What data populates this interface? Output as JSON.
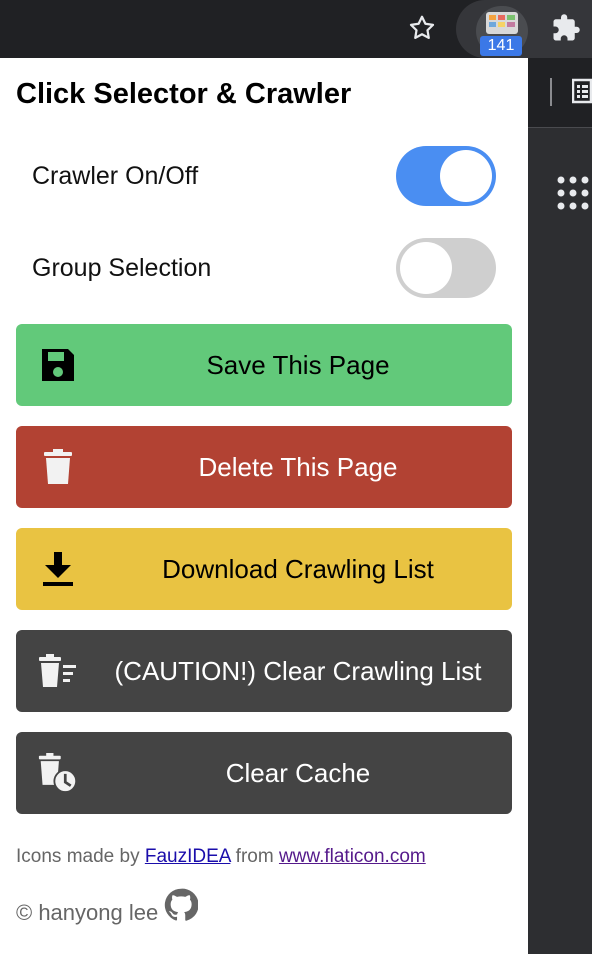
{
  "browser": {
    "extension_badge": "141"
  },
  "popup": {
    "title": "Click Selector & Crawler",
    "toggles": [
      {
        "label": "Crawler On/Off",
        "state": "on"
      },
      {
        "label": "Group Selection",
        "state": "off"
      }
    ],
    "buttons": {
      "save": {
        "label": "Save This Page",
        "icon": "floppy-disk-icon",
        "color": "#62c97a"
      },
      "delete": {
        "label": "Delete This Page",
        "icon": "trash-icon",
        "color": "#b24233"
      },
      "download": {
        "label": "Download Crawling List",
        "icon": "download-icon",
        "color": "#e9c342"
      },
      "clear_list": {
        "label": "(CAUTION!) Clear Crawling List",
        "icon": "trash-list-icon",
        "color": "#444444"
      },
      "clear_cache": {
        "label": "Clear Cache",
        "icon": "trash-clock-icon",
        "color": "#444444"
      }
    },
    "credits": {
      "prefix": "Icons made by ",
      "author": "FauzIDEA",
      "middle": " from ",
      "site": "www.flaticon.com"
    },
    "copyright": "© hanyong lee"
  }
}
